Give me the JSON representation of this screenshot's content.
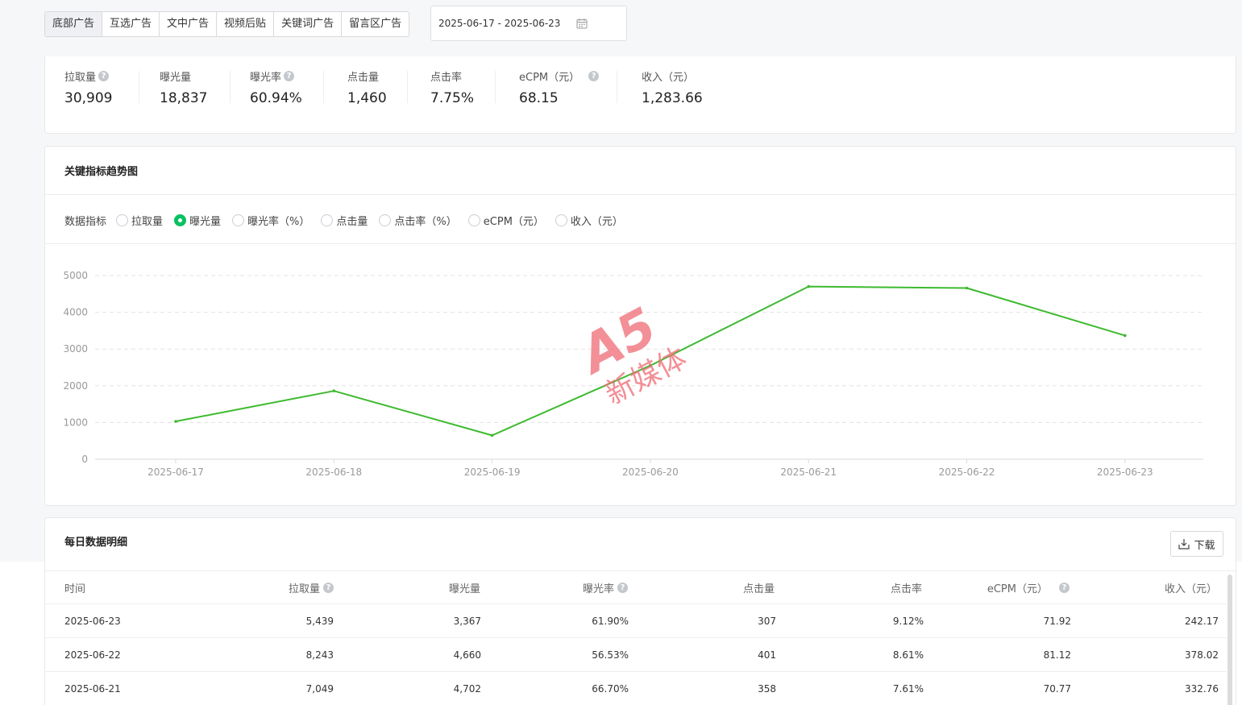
{
  "tabs": [
    {
      "label": "底部广告",
      "active": true
    },
    {
      "label": "互选广告",
      "active": false
    },
    {
      "label": "文中广告",
      "active": false
    },
    {
      "label": "视频后贴",
      "active": false
    },
    {
      "label": "关键词广告",
      "active": false
    },
    {
      "label": "留言区广告",
      "active": false
    }
  ],
  "date_range": "2025-06-17 - 2025-06-23",
  "summary": [
    {
      "label": "拉取量",
      "value": "30,909",
      "help": true
    },
    {
      "label": "曝光量",
      "value": "18,837",
      "help": false
    },
    {
      "label": "曝光率",
      "value": "60.94%",
      "help": true
    },
    {
      "label": "点击量",
      "value": "1,460",
      "help": false
    },
    {
      "label": "点击率",
      "value": "7.75%",
      "help": false
    },
    {
      "label": "eCPM（元）",
      "value": "68.15",
      "help": true
    },
    {
      "label": "收入（元）",
      "value": "1,283.66",
      "help": false
    }
  ],
  "trend": {
    "title": "关键指标趋势图",
    "metric_label": "数据指标",
    "options": [
      {
        "label": "拉取量",
        "checked": false
      },
      {
        "label": "曝光量",
        "checked": true
      },
      {
        "label": "曝光率（%）",
        "checked": false
      },
      {
        "label": "点击量",
        "checked": false
      },
      {
        "label": "点击率（%）",
        "checked": false
      },
      {
        "label": "eCPM（元）",
        "checked": false
      },
      {
        "label": "收入（元）",
        "checked": false
      }
    ]
  },
  "chart_data": {
    "type": "line",
    "x": [
      "2025-06-17",
      "2025-06-18",
      "2025-06-19",
      "2025-06-20",
      "2025-06-21",
      "2025-06-22",
      "2025-06-23"
    ],
    "series": [
      {
        "values": [
          1030,
          1860,
          650,
          2550,
          4702,
          4660,
          3367
        ],
        "color": "#3dba2f"
      }
    ],
    "yticks": [
      0,
      1000,
      2000,
      3000,
      4000,
      5000
    ],
    "ylim": [
      0,
      5000
    ],
    "grid": true
  },
  "detail": {
    "title": "每日数据明细",
    "download_label": "下载",
    "columns": [
      {
        "label": "时间",
        "help": false
      },
      {
        "label": "拉取量",
        "help": true
      },
      {
        "label": "曝光量",
        "help": false
      },
      {
        "label": "曝光率",
        "help": true
      },
      {
        "label": "点击量",
        "help": false
      },
      {
        "label": "点击率",
        "help": false
      },
      {
        "label": "eCPM（元）",
        "help": true
      },
      {
        "label": "收入（元）",
        "help": false
      }
    ],
    "rows": [
      [
        "2025-06-23",
        "5,439",
        "3,367",
        "61.90%",
        "307",
        "9.12%",
        "71.92",
        "242.17"
      ],
      [
        "2025-06-22",
        "8,243",
        "4,660",
        "56.53%",
        "401",
        "8.61%",
        "81.12",
        "378.02"
      ],
      [
        "2025-06-21",
        "7,049",
        "4,702",
        "66.70%",
        "358",
        "7.61%",
        "70.77",
        "332.76"
      ]
    ]
  },
  "watermark": {
    "text": "A5",
    "subtitle": "新媒体",
    "color": "#f06a73"
  }
}
